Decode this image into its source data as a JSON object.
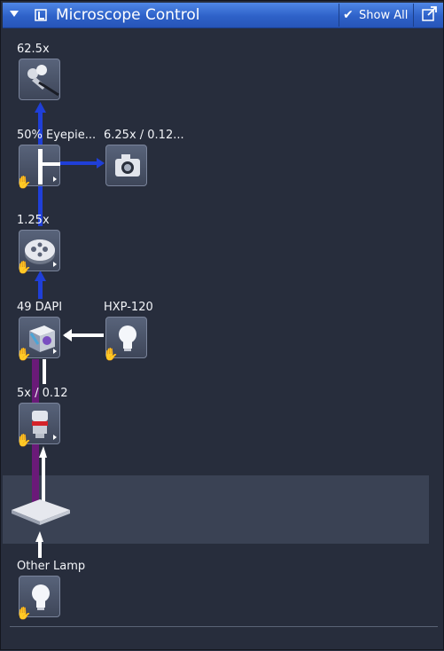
{
  "header": {
    "title": "Microscope Control",
    "show_all_label": "Show All",
    "icons": [
      "collapse-arrow-icon",
      "microscope-panel-icon",
      "checkmark-icon",
      "undock-icon"
    ]
  },
  "components": {
    "magnification": {
      "label": "62.5x",
      "icon": "eyepiece-icon"
    },
    "beam_splitter": {
      "label": "50% Eyepie...",
      "icon": "beam-splitter-icon"
    },
    "camera": {
      "label": "6.25x / 0.12...",
      "icon": "camera-icon"
    },
    "optovar": {
      "label": "1.25x",
      "icon": "optovar-turret-icon"
    },
    "reflector": {
      "label": "49 DAPI",
      "icon": "filter-cube-icon"
    },
    "fluorescence_lamp": {
      "label": "HXP-120",
      "icon": "lamp-bulb-icon"
    },
    "objective": {
      "label": "5x / 0.12",
      "icon": "objective-icon"
    },
    "other_lamp": {
      "label": "Other Lamp",
      "icon": "lamp-bulb-icon"
    }
  },
  "colors": {
    "header_blue": "#3a6fd8",
    "light_path_blue": "#1f3fd8",
    "excitation_purple": "#6a1a78",
    "panel_bg": "#272d3c"
  }
}
